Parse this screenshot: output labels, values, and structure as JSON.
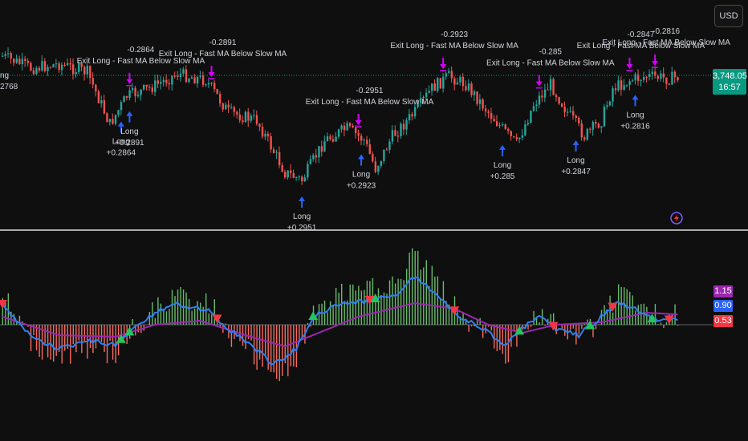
{
  "currency_button": "USD",
  "price_label": {
    "price": "3,748.05",
    "countdown": "16:57"
  },
  "indicator_labels": [
    {
      "value": "1.15",
      "color": "#9c27b0"
    },
    {
      "value": "0.90",
      "color": "#2962ff"
    },
    {
      "value": "0.53",
      "color": "#f23645"
    }
  ],
  "colors": {
    "background": "#0f0f0f",
    "bull_candle": "#26a69a",
    "bear_candle": "#ef5350",
    "long_arrow": "#2962ff",
    "exit_arrow": "#d500f9",
    "fast_line": "#2f7ff0",
    "slow_line": "#9c27b0",
    "hist_pos": "#66bb6a",
    "hist_neg": "#f76b5f",
    "buy_triangle": "#22c55e",
    "sell_triangle": "#f23645"
  },
  "chart_data": [
    {
      "type": "candlestick",
      "title": "",
      "current_price": 3748.05,
      "price_line": "dotted",
      "trades": [
        {
          "kind": "exit",
          "text": "Exit Long - Fast MA Below Slow MA",
          "pnl": "-0.2864",
          "bar": 45
        },
        {
          "kind": "long",
          "text": "Long",
          "pnl": "+0.2864",
          "bar": 42
        },
        {
          "kind": "long",
          "text": "Long",
          "pnl": "+0.2891",
          "bar": 45
        },
        {
          "kind": "exit",
          "text": "Exit Long - Fast MA Below Slow MA",
          "pnl": "-0.2891",
          "bar": 74
        },
        {
          "kind": "exit",
          "text": "Exit Long - Fast MA Below Slow MA",
          "pnl": "-0.2951",
          "bar": 126
        },
        {
          "kind": "long",
          "text": "Long",
          "pnl": "+0.2951",
          "bar": 106
        },
        {
          "kind": "long",
          "text": "Long",
          "pnl": "+0.2923",
          "bar": 127
        },
        {
          "kind": "exit",
          "text": "Exit Long - Fast MA Below Slow MA",
          "pnl": "-0.2923",
          "bar": 156
        },
        {
          "kind": "long",
          "text": "Long",
          "pnl": "+0.285",
          "bar": 177
        },
        {
          "kind": "exit",
          "text": "Exit Long - Fast MA Below Slow MA",
          "pnl": "-0.285",
          "bar": 190
        },
        {
          "kind": "long",
          "text": "Long",
          "pnl": "+0.2847",
          "bar": 203
        },
        {
          "kind": "exit",
          "text": "Exit Long - Fast MA Below Slow MA",
          "pnl": "-0.2847",
          "bar": 222
        },
        {
          "kind": "long",
          "text": "Long",
          "pnl": "+0.2816",
          "bar": 224
        },
        {
          "kind": "exit",
          "text": "Exit Long - Fast MA Below Slow MA",
          "pnl": "-0.2816",
          "bar": 231
        }
      ],
      "left_cutoff_labels": [
        "ng",
        "2768"
      ]
    },
    {
      "type": "histogram+line",
      "title": "",
      "series": [
        {
          "values": "histogram",
          "color": "#66bb6a / #f76b5f"
        },
        {
          "values": "fast",
          "color": "#2f7ff0"
        },
        {
          "values": "slow",
          "color": "#9c27b0"
        }
      ]
    }
  ]
}
